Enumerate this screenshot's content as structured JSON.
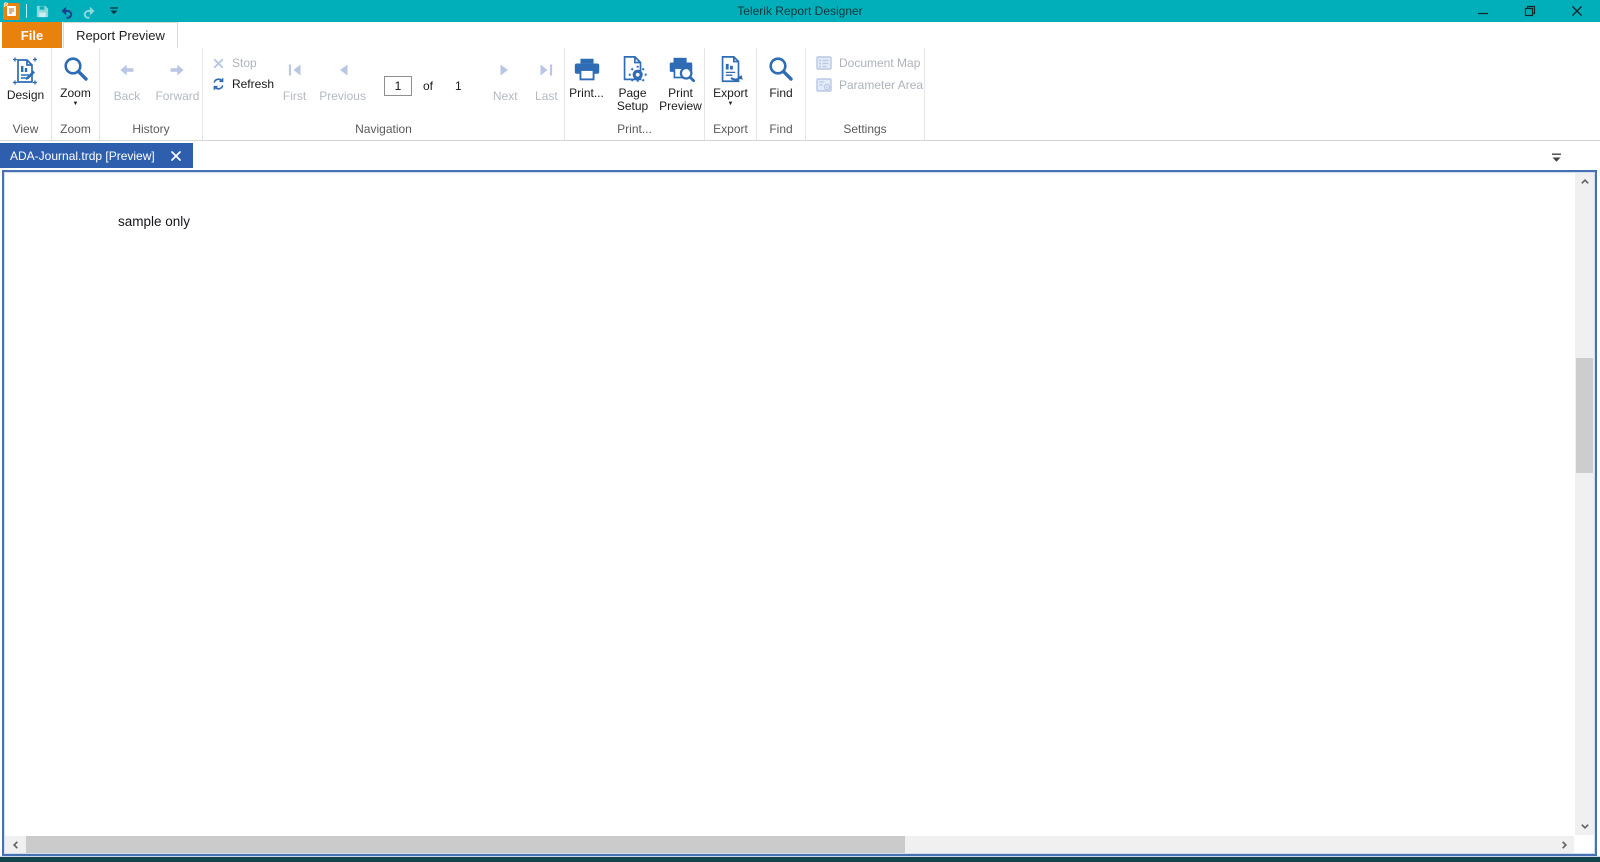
{
  "titlebar": {
    "title": "Telerik Report Designer"
  },
  "tabs": {
    "file": "File",
    "report_preview": "Report Preview"
  },
  "ribbon": {
    "view": {
      "design": "Design",
      "group": "View"
    },
    "zoom": {
      "button": "Zoom",
      "group": "Zoom"
    },
    "history": {
      "back": "Back",
      "forward": "Forward",
      "group": "History"
    },
    "navigation": {
      "stop": "Stop",
      "refresh": "Refresh",
      "first": "First",
      "previous": "Previous",
      "page_value": "1",
      "of": "of",
      "total_pages": "1",
      "next": "Next",
      "last": "Last",
      "group": "Navigation"
    },
    "print": {
      "print": "Print...",
      "page_setup": "Page Setup",
      "print_preview": "Print Preview",
      "group": "Print..."
    },
    "export": {
      "button": "Export",
      "group": "Export"
    },
    "find": {
      "button": "Find",
      "group": "Find"
    },
    "settings": {
      "document_map": "Document Map",
      "parameter_area": "Parameter Area",
      "group": "Settings"
    }
  },
  "document_tab": {
    "title": "ADA-Journal.trdp [Preview]"
  },
  "report": {
    "sample_text": "sample only"
  },
  "icons": {
    "zoom_caret": "▼",
    "export_caret": "▼"
  },
  "colors": {
    "titlebar_teal": "#00AFB9",
    "file_tab_orange": "#E8820D",
    "document_tab_blue": "#2E5FAE",
    "icon_blue": "#2E6CB5",
    "icon_disabled": "#B9C7E4",
    "panel_border_blue": "#4672B4",
    "window_bottom": "#11464F"
  }
}
